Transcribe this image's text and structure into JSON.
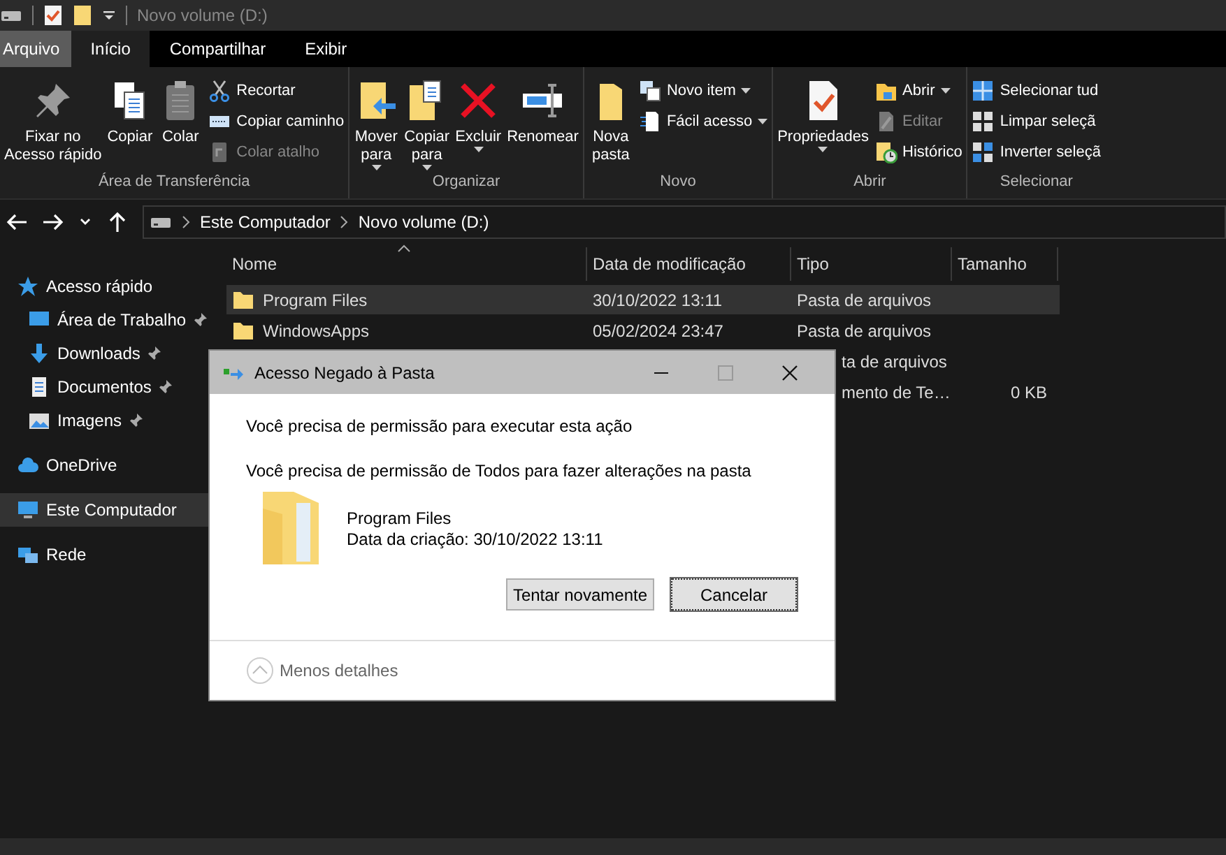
{
  "window": {
    "title": "Novo volume (D:)"
  },
  "ribbon_tabs": [
    {
      "label": "Arquivo",
      "kind": "file",
      "selected": false
    },
    {
      "label": "Início",
      "kind": "tab",
      "selected": true
    },
    {
      "label": "Compartilhar",
      "kind": "tab",
      "selected": false
    },
    {
      "label": "Exibir",
      "kind": "tab",
      "selected": false
    }
  ],
  "ribbon_groups": [
    {
      "label": "Área de Transferência",
      "items": [
        {
          "label": "Fixar no\nAcesso rápido",
          "kind": "large",
          "disabled": false,
          "has_menu": false
        },
        {
          "label": "Copiar",
          "kind": "large",
          "disabled": false,
          "has_menu": false
        },
        {
          "label": "Colar",
          "kind": "large",
          "disabled": false,
          "has_menu": false
        },
        {
          "label": "Recortar",
          "kind": "small",
          "disabled": false,
          "has_menu": false
        },
        {
          "label": "Copiar caminho",
          "kind": "small",
          "disabled": false,
          "has_menu": false
        },
        {
          "label": "Colar atalho",
          "kind": "small",
          "disabled": true,
          "has_menu": false
        }
      ]
    },
    {
      "label": "Organizar",
      "items": [
        {
          "label": "Mover\npara",
          "kind": "large",
          "disabled": false,
          "has_menu": true
        },
        {
          "label": "Copiar\npara",
          "kind": "large",
          "disabled": false,
          "has_menu": true
        },
        {
          "label": "Excluir",
          "kind": "large",
          "disabled": false,
          "has_menu": true
        },
        {
          "label": "Renomear",
          "kind": "large",
          "disabled": false,
          "has_menu": false
        }
      ]
    },
    {
      "label": "Novo",
      "items": [
        {
          "label": "Nova\npasta",
          "kind": "large",
          "disabled": false,
          "has_menu": false
        },
        {
          "label": "Novo item",
          "kind": "small",
          "disabled": false,
          "has_menu": true
        },
        {
          "label": "Fácil acesso",
          "kind": "small",
          "disabled": false,
          "has_menu": true
        }
      ]
    },
    {
      "label": "Abrir",
      "items": [
        {
          "label": "Propriedades",
          "kind": "large",
          "disabled": false,
          "has_menu": true
        },
        {
          "label": "Abrir",
          "kind": "small",
          "disabled": false,
          "has_menu": true
        },
        {
          "label": "Editar",
          "kind": "small",
          "disabled": true,
          "has_menu": false
        },
        {
          "label": "Histórico",
          "kind": "small",
          "disabled": false,
          "has_menu": false
        }
      ]
    },
    {
      "label": "Selecionar",
      "items": [
        {
          "label": "Selecionar tud",
          "kind": "small",
          "disabled": false,
          "has_menu": false
        },
        {
          "label": "Limpar seleçã",
          "kind": "small",
          "disabled": false,
          "has_menu": false
        },
        {
          "label": "Inverter seleçã",
          "kind": "small",
          "disabled": false,
          "has_menu": false
        }
      ]
    }
  ],
  "address_bar": {
    "path": [
      "Este Computador",
      "Novo volume (D:)"
    ]
  },
  "sidebar": {
    "items": [
      {
        "label": "Acesso rápido",
        "pinned": false,
        "selected": false,
        "children": [
          {
            "label": "Área de Trabalho",
            "pinned": true,
            "selected": false
          },
          {
            "label": "Downloads",
            "pinned": true,
            "selected": false
          },
          {
            "label": "Documentos",
            "pinned": true,
            "selected": false
          },
          {
            "label": "Imagens",
            "pinned": true,
            "selected": false
          }
        ]
      },
      {
        "label": "OneDrive",
        "pinned": false,
        "selected": false
      },
      {
        "label": "Este Computador",
        "pinned": false,
        "selected": true
      },
      {
        "label": "Rede",
        "pinned": false,
        "selected": false
      }
    ]
  },
  "table": {
    "columns": [
      "Nome",
      "Data de modificação",
      "Tipo",
      "Tamanho"
    ],
    "rows": [
      {
        "kind": "folder",
        "selected": true,
        "name": "Program Files",
        "modified": "30/10/2022 13:11",
        "type": "Pasta de arquivos",
        "size": ""
      },
      {
        "kind": "folder",
        "selected": false,
        "name": "WindowsApps",
        "modified": "05/02/2024 23:47",
        "type": "Pasta de arquivos",
        "size": ""
      },
      {
        "kind": "covered",
        "selected": false,
        "name": "",
        "modified": "",
        "type": "ta de arquivos",
        "size": ""
      },
      {
        "kind": "covered",
        "selected": false,
        "name": "",
        "modified": "",
        "type": "mento de Te…",
        "size": "0 KB"
      }
    ]
  },
  "dialog": {
    "title": "Acesso Negado à Pasta",
    "message": "Você precisa de permissão para executar esta ação",
    "detail": "Você precisa de permissão de Todos para fazer alterações na pasta",
    "item_name": "Program Files",
    "item_date": "Data da criação: 30/10/2022 13:11",
    "buttons": [
      {
        "label": "Tentar novamente",
        "default": false
      },
      {
        "label": "Cancelar",
        "default": true
      }
    ],
    "toggle": "Menos detalhes"
  }
}
